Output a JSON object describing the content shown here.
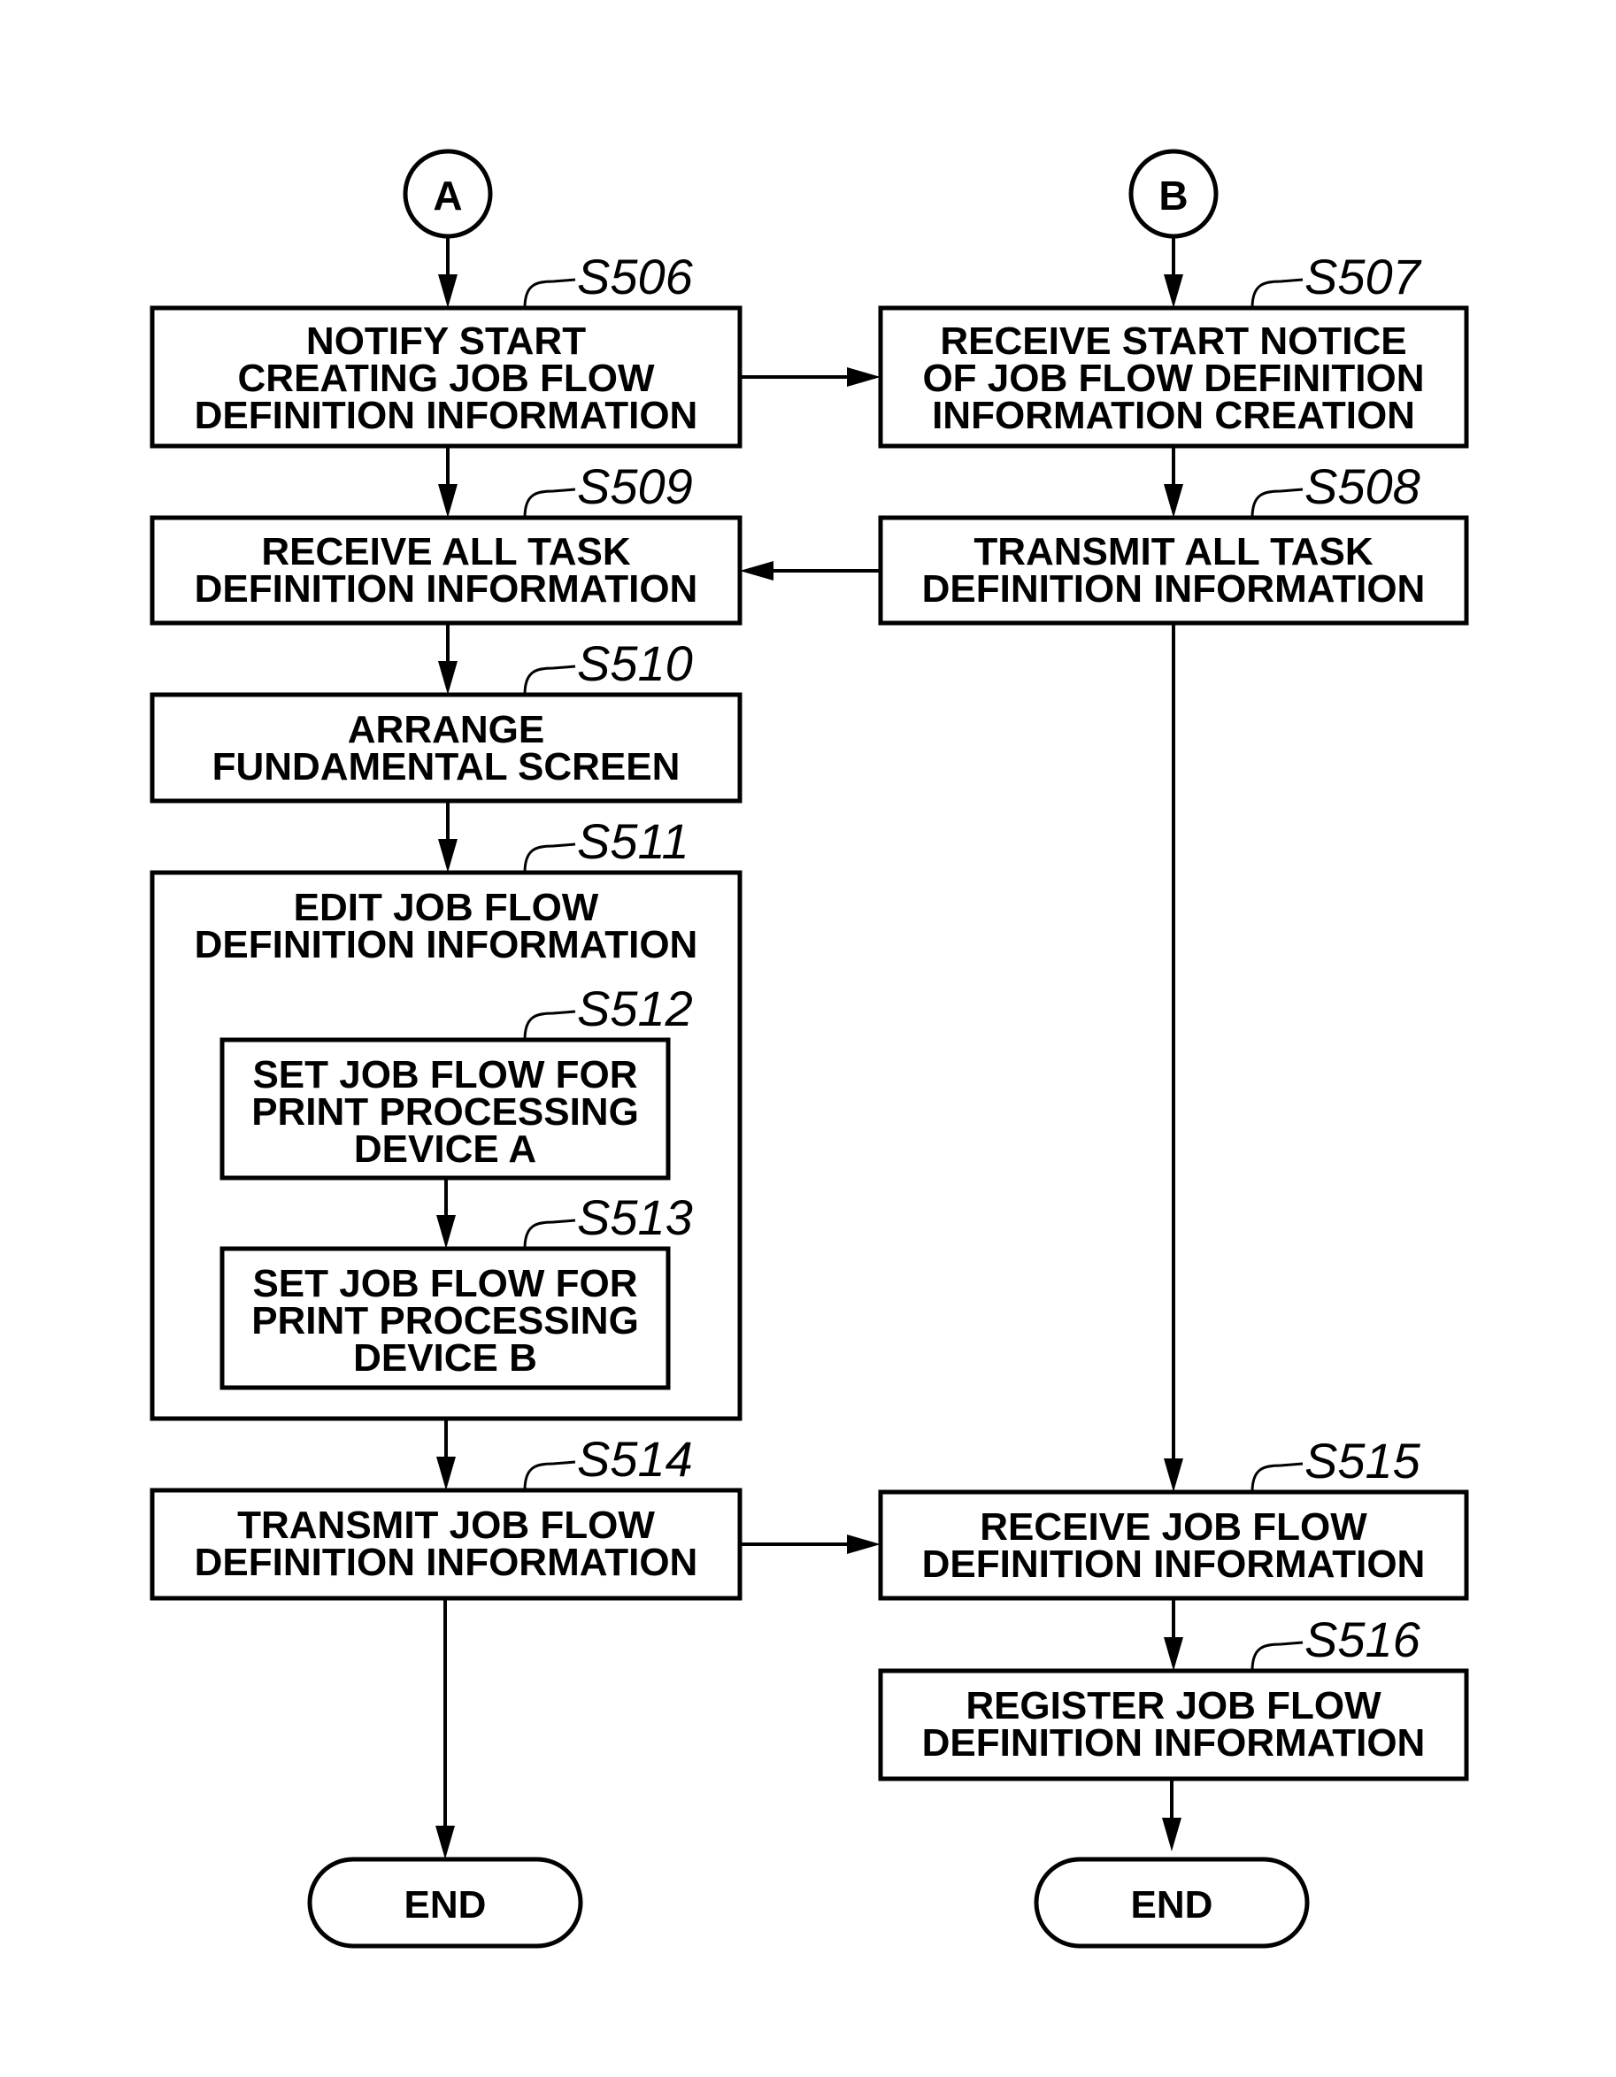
{
  "diagram": {
    "type": "flowchart",
    "connectors": {
      "left": "A",
      "right": "B"
    },
    "steps": {
      "s506": {
        "id": "S506",
        "lines": [
          "NOTIFY START",
          "CREATING JOB FLOW",
          "DEFINITION INFORMATION"
        ]
      },
      "s507": {
        "id": "S507",
        "lines": [
          "RECEIVE START NOTICE",
          "OF JOB FLOW DEFINITION",
          "INFORMATION CREATION"
        ]
      },
      "s508": {
        "id": "S508",
        "lines": [
          "TRANSMIT ALL TASK",
          "DEFINITION INFORMATION"
        ]
      },
      "s509": {
        "id": "S509",
        "lines": [
          "RECEIVE ALL TASK",
          "DEFINITION INFORMATION"
        ]
      },
      "s510": {
        "id": "S510",
        "lines": [
          "ARRANGE",
          "FUNDAMENTAL SCREEN"
        ]
      },
      "s511": {
        "id": "S511",
        "lines": [
          "EDIT JOB FLOW",
          "DEFINITION INFORMATION"
        ]
      },
      "s512": {
        "id": "S512",
        "lines": [
          "SET JOB FLOW FOR",
          "PRINT PROCESSING",
          "DEVICE A"
        ]
      },
      "s513": {
        "id": "S513",
        "lines": [
          "SET JOB FLOW FOR",
          "PRINT PROCESSING",
          "DEVICE B"
        ]
      },
      "s514": {
        "id": "S514",
        "lines": [
          "TRANSMIT JOB FLOW",
          "DEFINITION INFORMATION"
        ]
      },
      "s515": {
        "id": "S515",
        "lines": [
          "RECEIVE JOB FLOW",
          "DEFINITION INFORMATION"
        ]
      },
      "s516": {
        "id": "S516",
        "lines": [
          "REGISTER JOB FLOW",
          "DEFINITION INFORMATION"
        ]
      }
    },
    "terminals": {
      "left_end": "END",
      "right_end": "END"
    },
    "edges": [
      [
        "A",
        "S506"
      ],
      [
        "S506",
        "S507"
      ],
      [
        "S506",
        "S509"
      ],
      [
        "B",
        "S507"
      ],
      [
        "S507",
        "S508"
      ],
      [
        "S508",
        "S509"
      ],
      [
        "S509",
        "S510"
      ],
      [
        "S510",
        "S511"
      ],
      [
        "S512",
        "S513"
      ],
      [
        "S511",
        "S514"
      ],
      [
        "S508",
        "S515"
      ],
      [
        "S514",
        "S515"
      ],
      [
        "S515",
        "S516"
      ],
      [
        "S514",
        "END"
      ],
      [
        "S516",
        "END"
      ]
    ]
  }
}
